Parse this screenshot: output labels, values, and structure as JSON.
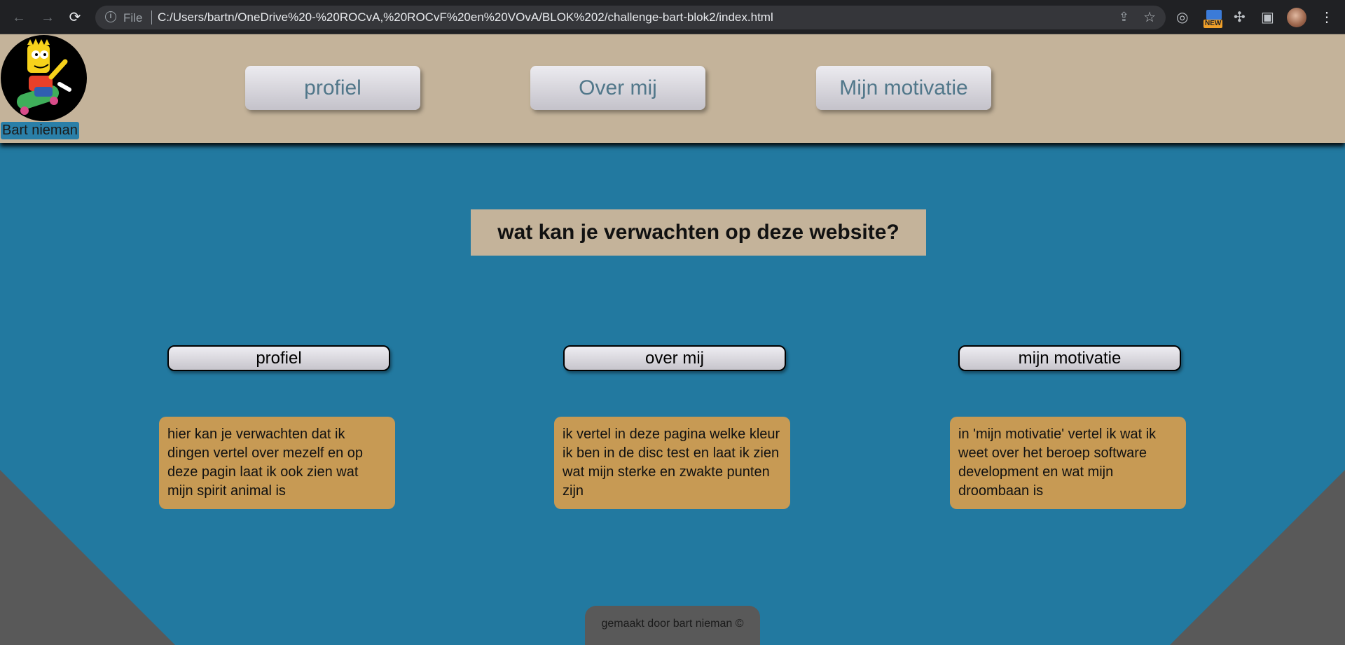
{
  "browser": {
    "url_scheme_label": "File",
    "url": "C:/Users/bartn/OneDrive%20-%20ROCvA,%20ROCvF%20en%20VOvA/BLOK%202/challenge-bart-blok2/index.html",
    "new_badge": "NEW"
  },
  "header": {
    "owner_name": "Bart nieman",
    "nav": [
      {
        "label": "profiel"
      },
      {
        "label": "Over mij"
      },
      {
        "label": "Mijn motivatie"
      }
    ]
  },
  "main": {
    "heading": "wat kan je verwachten op deze website?",
    "cards": [
      {
        "title": "profiel",
        "text": "hier kan je verwachten dat ik dingen vertel over mezelf en op deze pagin laat ik ook zien wat mijn spirit animal is"
      },
      {
        "title": "over mij",
        "text": "ik vertel in deze pagina welke kleur ik ben in de disc test en laat ik zien wat mijn sterke en zwakte punten zijn"
      },
      {
        "title": "mijn motivatie",
        "text": "in 'mijn motivatie' vertel ik wat ik weet over het beroep software development en wat mijn droombaan is"
      }
    ]
  },
  "footer": {
    "text": "gemaakt door bart nieman ©"
  },
  "colors": {
    "page_bg": "#2279a0",
    "header_bg": "#c4b39a",
    "card_bg": "#c79a54",
    "corner": "#595959"
  }
}
